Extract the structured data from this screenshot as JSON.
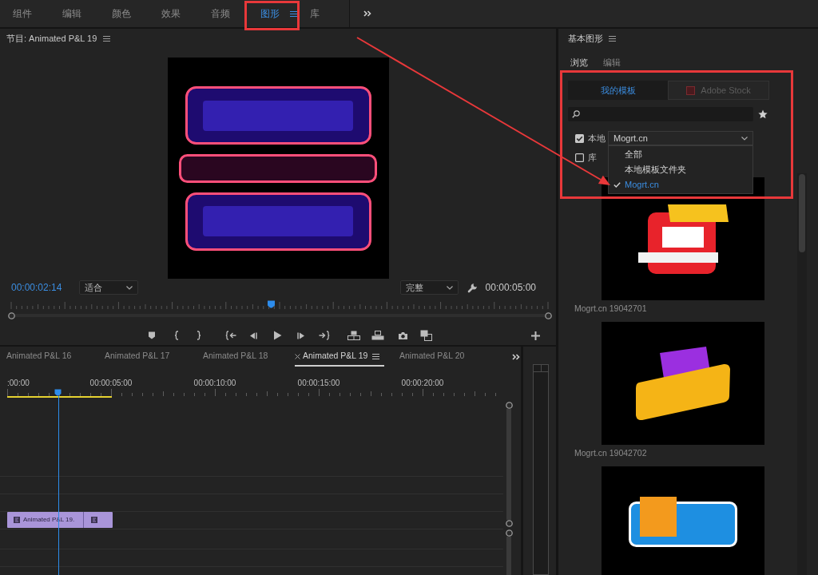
{
  "workspace_tabs": [
    {
      "label": "组件",
      "selected": false
    },
    {
      "label": "编辑",
      "selected": false
    },
    {
      "label": "颜色",
      "selected": false
    },
    {
      "label": "效果",
      "selected": false
    },
    {
      "label": "音频",
      "selected": false
    },
    {
      "label": "图形",
      "selected": true
    },
    {
      "label": "库",
      "selected": false
    }
  ],
  "program_monitor": {
    "title": "节目: Animated P&L 19",
    "timecode": "00:00:02:14",
    "zoom_dropdown": "适合",
    "quality_dropdown": "完整",
    "duration": "00:00:05:00",
    "playhead": {
      "level": 0.485
    }
  },
  "timeline": {
    "tabs": [
      {
        "label": "Animated P&L 16",
        "selected": false
      },
      {
        "label": "Animated P&L 17",
        "selected": false
      },
      {
        "label": "Animated P&L 18",
        "selected": false
      },
      {
        "label": "Animated P&L 19",
        "selected": true
      },
      {
        "label": "Animated P&L 20",
        "selected": false
      }
    ],
    "ruler_labels": [
      ":00:00",
      "00:00:05:00",
      "00:00:10:00",
      "00:00:15:00",
      "00:00:20:00"
    ],
    "playhead": {
      "level": 0.103
    },
    "clip": {
      "label": "Animated P&L 19."
    }
  },
  "essential_graphics": {
    "title": "基本图形",
    "tabs": [
      {
        "label": "浏览",
        "selected": true
      },
      {
        "label": "编辑",
        "selected": false
      }
    ],
    "sources": [
      {
        "label": "我的模板",
        "selected": true,
        "kind": "local"
      },
      {
        "label": "Adobe Stock",
        "selected": false,
        "kind": "stock"
      }
    ],
    "filters": [
      {
        "label": "本地",
        "checked": true
      },
      {
        "label": "库",
        "checked": false
      }
    ],
    "location": {
      "value": "Mogrt.cn",
      "expanded": true,
      "options": [
        {
          "label": "全部",
          "selected": false
        },
        {
          "label": "本地模板文件夹",
          "selected": false
        },
        {
          "label": "Mogrt.cn",
          "selected": true
        }
      ]
    },
    "templates": [
      {
        "name": "Mogrt.cn 19042701",
        "kind": "square",
        "color": "#e8232b"
      },
      {
        "name": "Mogrt.cn 19042702",
        "kind": "tilted",
        "color": "#f5b416"
      },
      {
        "kind": "wide",
        "color": "#1e8fe1"
      }
    ]
  }
}
